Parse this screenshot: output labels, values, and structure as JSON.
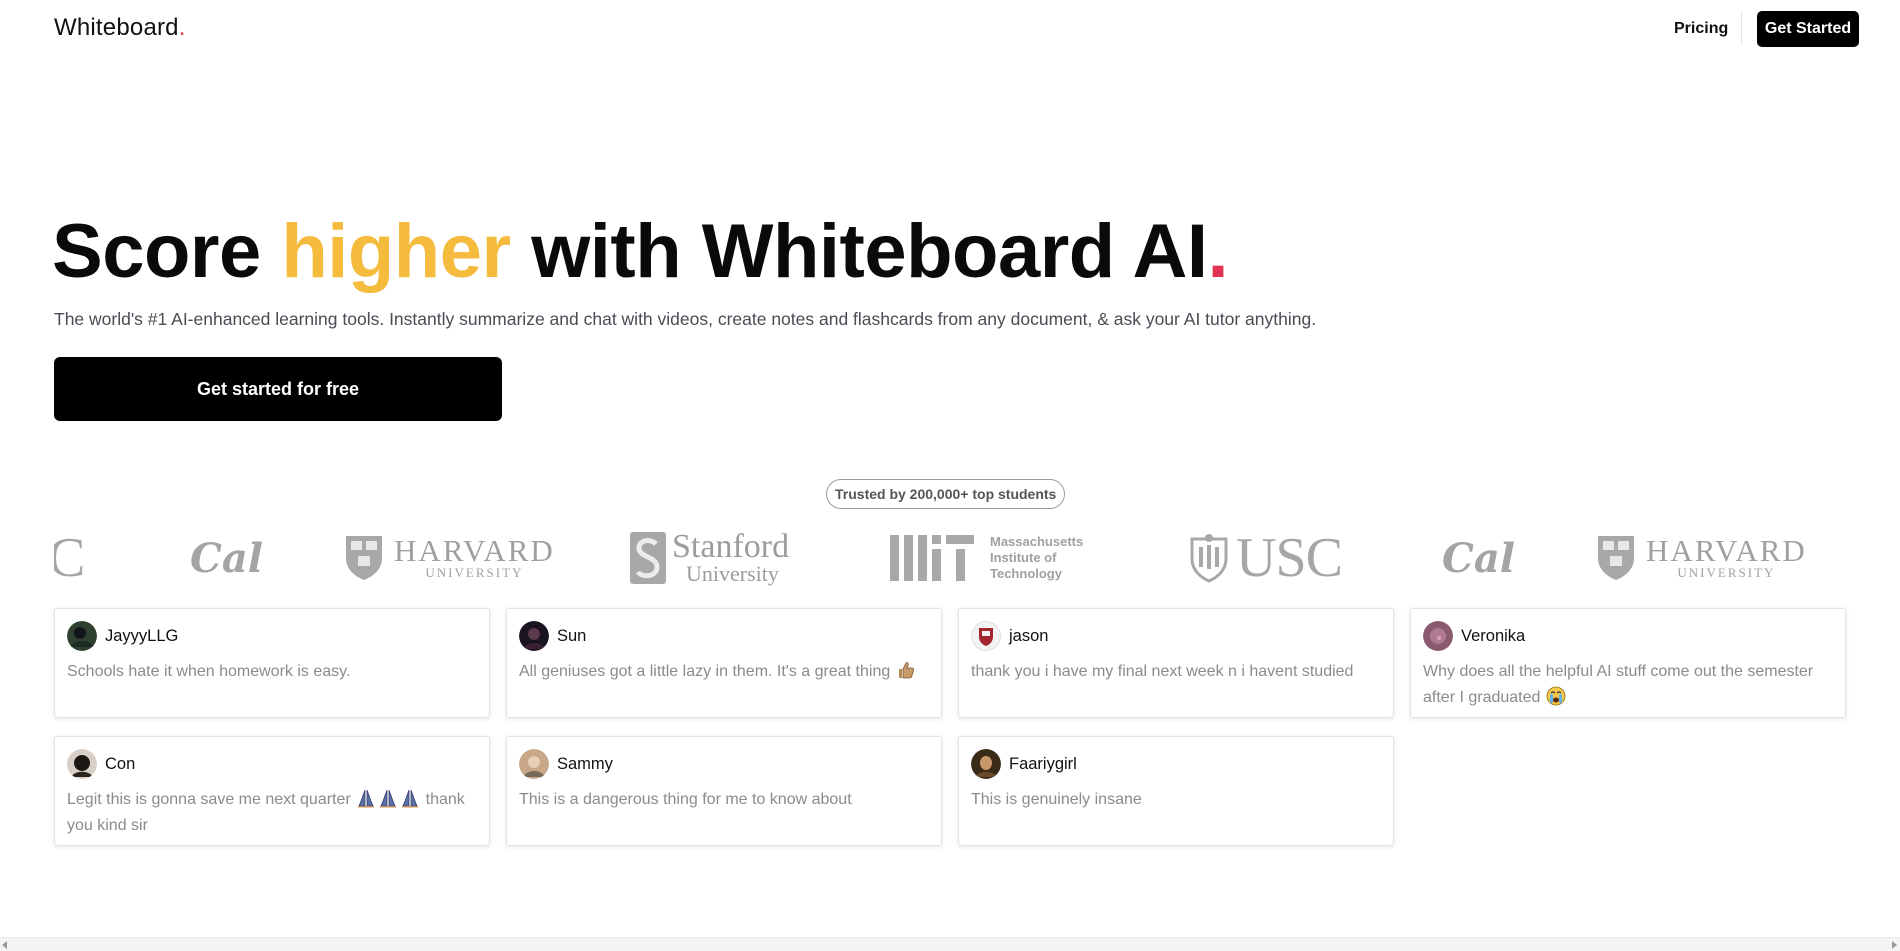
{
  "header": {
    "logo_text": "Whiteboard",
    "logo_dot": ".",
    "nav_pricing": "Pricing",
    "nav_cta": "Get Started"
  },
  "hero": {
    "title_part1": "Score ",
    "title_accent": "higher",
    "title_part2": " with Whiteboard AI",
    "title_dot": ".",
    "subtitle": "The world's #1 AI-enhanced learning tools. Instantly summarize and chat with videos, create notes and flashcards from any document, & ask your AI tutor anything.",
    "cta_label": "Get started for free"
  },
  "trusted_badge": "Trusted by 200,000+ top students",
  "university_logos": {
    "usc_partial": "C",
    "cal": "Cal",
    "harvard": {
      "name": "HARVARD",
      "sub": "UNIVERSITY"
    },
    "stanford": {
      "name": "Stanford",
      "sub": "University"
    },
    "mit": {
      "line1": "Massachusetts",
      "line2": "Institute of",
      "line3": "Technology"
    },
    "usc": "USC"
  },
  "testimonials": [
    {
      "name": "JayyyLLG",
      "text": "Schools hate it when homework is easy."
    },
    {
      "name": "Sun",
      "text": "All geniuses got a little lazy in them. It's a great thing"
    },
    {
      "name": "jason",
      "text": "thank you i have my final next week n i havent studied"
    },
    {
      "name": "Veronika",
      "text": "Why does all the helpful AI stuff come out the semester after I graduated"
    },
    {
      "name": "Con",
      "text": "Legit this is gonna save me next quarter",
      "text_after": "thank you kind sir"
    },
    {
      "name": "Sammy",
      "text": "This is a dangerous thing for me to know about"
    },
    {
      "name": "Faariygirl",
      "text": "This is genuinely insane"
    }
  ],
  "icons": {
    "thumbs_up": "thumbs-up-icon",
    "crying": "crying-face-icon",
    "pray": "praying-hands-icon"
  },
  "colors": {
    "accent_yellow": "#f4bb3d",
    "dot_red": "#e0334f",
    "cta_black": "#000000"
  }
}
